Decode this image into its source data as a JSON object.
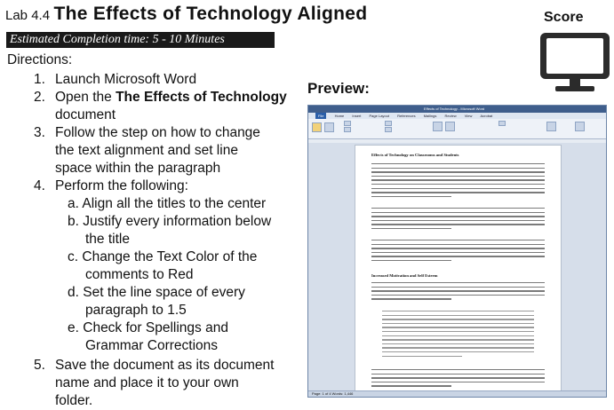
{
  "header": {
    "lab_number": "Lab 4.4",
    "lab_title": "The Effects of Technology Aligned",
    "estimated_time": "Estimated Completion time: 5 - 10 Minutes"
  },
  "directions_label": "Directions:",
  "steps": [
    {
      "num": "1.",
      "lines": [
        "Launch Microsoft Word"
      ]
    },
    {
      "num": "2.",
      "lines_html": true,
      "prefix": "Open the ",
      "bold": "The Effects of Technology",
      "lines": [
        "document"
      ]
    },
    {
      "num": "3.",
      "lines": [
        "Follow the step on how to change",
        "the text alignment and set line",
        "space within the paragraph"
      ]
    },
    {
      "num": "4.",
      "lines": [
        "Perform the following:"
      ]
    },
    {
      "num": "5.",
      "lines": [
        "Save the document as its document",
        "name and place it to your own",
        "folder."
      ]
    }
  ],
  "substeps": [
    {
      "letter": "a.",
      "lines": [
        "Align all the titles to the center"
      ]
    },
    {
      "letter": "b.",
      "lines": [
        "Justify every information below",
        "the title"
      ]
    },
    {
      "letter": "c.",
      "lines": [
        "Change the Text Color of the",
        "comments to Red"
      ]
    },
    {
      "letter": "d.",
      "lines": [
        "Set the line space of every",
        "paragraph to 1.5"
      ]
    },
    {
      "letter": "e.",
      "lines": [
        "Check for Spellings and",
        "Grammar Corrections"
      ]
    }
  ],
  "score_label": "Score",
  "preview_label": "Preview:",
  "preview": {
    "window_title": "Effects of Technology - Microsoft Word",
    "tabs": [
      "File",
      "Home",
      "Insert",
      "Page Layout",
      "References",
      "Mailings",
      "Review",
      "View",
      "Acrobat"
    ],
    "doc_heading_1": "Effects of Technology on Classrooms and Students",
    "doc_heading_2": "Increased Motivation and Self Esteem",
    "status": "Page: 1 of 4   Words: 1,446"
  }
}
